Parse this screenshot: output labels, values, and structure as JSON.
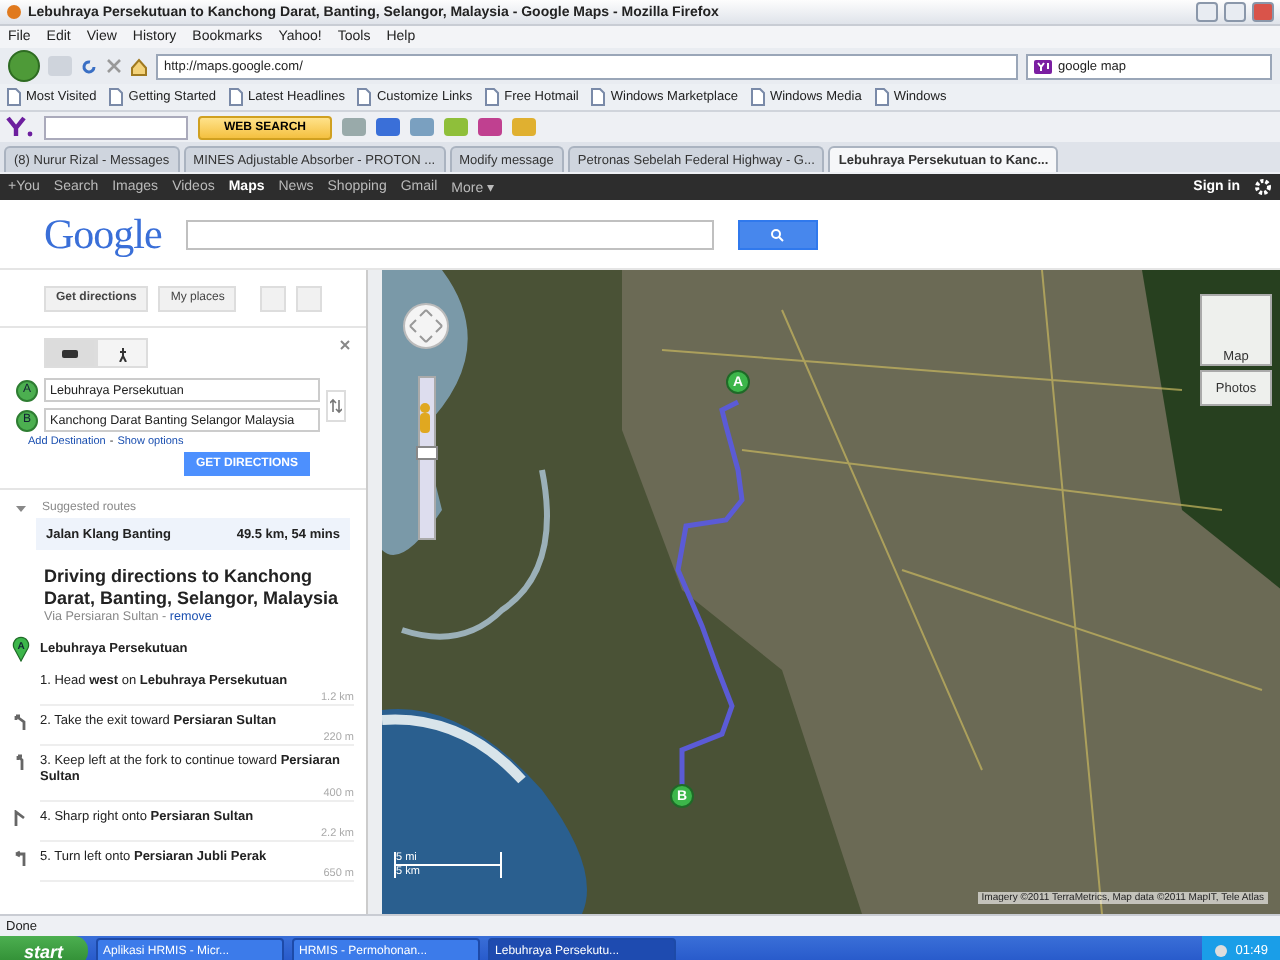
{
  "window": {
    "title": "Lebuhraya Persekutuan to Kanchong Darat, Banting, Selangor, Malaysia - Google Maps - Mozilla Firefox"
  },
  "menu": [
    "File",
    "Edit",
    "View",
    "History",
    "Bookmarks",
    "Yahoo!",
    "Tools",
    "Help"
  ],
  "nav": {
    "url": "http://maps.google.com/",
    "search_value": "google map"
  },
  "bookmarks": [
    "Most Visited",
    "Getting Started",
    "Latest Headlines",
    "Customize Links",
    "Free Hotmail",
    "Windows Marketplace",
    "Windows Media",
    "Windows"
  ],
  "yahoo_toolbar": {
    "button": "WEB SEARCH"
  },
  "tabs": [
    {
      "label": "(8) Nurur Rizal - Messages",
      "selected": false
    },
    {
      "label": "MINES Adjustable Absorber - PROTON ...",
      "selected": false
    },
    {
      "label": "Modify message",
      "selected": false
    },
    {
      "label": "Petronas Sebelah Federal Highway - G...",
      "selected": false
    },
    {
      "label": "Lebuhraya Persekutuan to Kanc...",
      "selected": true
    }
  ],
  "google_bar": {
    "links": [
      {
        "label": "+You",
        "selected": false
      },
      {
        "label": "Search",
        "selected": false
      },
      {
        "label": "Images",
        "selected": false
      },
      {
        "label": "Videos",
        "selected": false
      },
      {
        "label": "Maps",
        "selected": true
      },
      {
        "label": "News",
        "selected": false
      },
      {
        "label": "Shopping",
        "selected": false
      },
      {
        "label": "Gmail",
        "selected": false
      },
      {
        "label": "More ▾",
        "selected": false
      }
    ],
    "sign_in": "Sign in"
  },
  "header": {
    "logo": "Google"
  },
  "panel": {
    "buttons": [
      "Get directions",
      "My places"
    ],
    "modes": [
      {
        "kind": "car",
        "selected": true
      },
      {
        "kind": "walk",
        "selected": false
      }
    ],
    "waypoints": [
      {
        "marker": "A",
        "value": "Lebuhraya Persekutuan"
      },
      {
        "marker": "B",
        "value": "Kanchong Darat Banting Selangor Malaysia"
      }
    ],
    "add_destination": "Add Destination",
    "separator": "-",
    "show_options": "Show options",
    "get_directions": "GET DIRECTIONS",
    "suggested_label": "Suggested routes",
    "route": {
      "name": "Jalan Klang Banting",
      "summary": "49.5 km, 54 mins"
    },
    "heading": "Driving directions to Kanchong Darat, Banting, Selangor, Malaysia",
    "via": "Via Persiaran Sultan - ",
    "remove": "remove",
    "start": {
      "marker": "A",
      "label": "Lebuhraya Persekutuan"
    },
    "steps": [
      {
        "kind": "straight",
        "text": "1. Head **west** on **Lebuhraya Persekutuan**",
        "distance": "1.2 km"
      },
      {
        "kind": "exit",
        "text": "2. Take the exit toward **Persiaran Sultan**",
        "distance": "220 m"
      },
      {
        "kind": "keep-left",
        "text": "3. Keep left at the fork to continue toward **Persiaran Sultan**",
        "distance": "400 m"
      },
      {
        "kind": "sharp-right",
        "text": "4. Sharp right onto **Persiaran Sultan**",
        "distance": "2.2 km"
      },
      {
        "kind": "turn-left",
        "text": "5. Turn left onto **Persiaran Jubli Perak**",
        "distance": "650 m"
      }
    ]
  },
  "map": {
    "zoom": {
      "level": 0.55
    },
    "type_buttons": [
      "Map",
      "Photos"
    ],
    "markers": [
      "A",
      "B"
    ],
    "scale": [
      "5 mi",
      "5 km"
    ],
    "copyright": "Imagery ©2011 TerraMetrics, Map data ©2011 MapIT, Tele Atlas"
  },
  "status": "Done",
  "taskbar": {
    "start": "start",
    "items": [
      "Aplikasi HRMIS - Micr...",
      "HRMIS - Permohonan...",
      "Lebuhraya Persekutu..."
    ],
    "clock": "01:49"
  }
}
